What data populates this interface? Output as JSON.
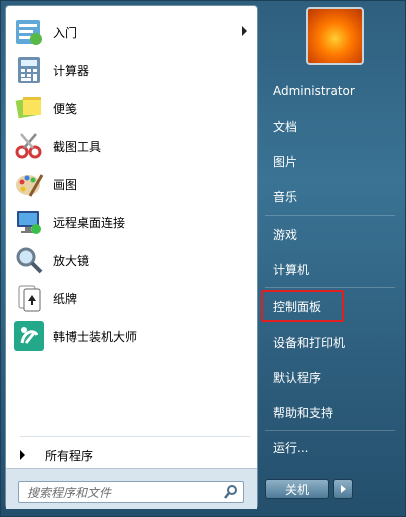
{
  "left": {
    "programs": [
      {
        "label": "入门",
        "icon": "getting-started-icon",
        "has_submenu": true
      },
      {
        "label": "计算器",
        "icon": "calculator-icon",
        "has_submenu": false
      },
      {
        "label": "便笺",
        "icon": "sticky-notes-icon",
        "has_submenu": false
      },
      {
        "label": "截图工具",
        "icon": "snipping-tool-icon",
        "has_submenu": false
      },
      {
        "label": "画图",
        "icon": "paint-icon",
        "has_submenu": false
      },
      {
        "label": "远程桌面连接",
        "icon": "remote-desktop-icon",
        "has_submenu": false
      },
      {
        "label": "放大镜",
        "icon": "magnifier-icon",
        "has_submenu": false
      },
      {
        "label": "纸牌",
        "icon": "solitaire-icon",
        "has_submenu": false
      },
      {
        "label": "韩博士装机大师",
        "icon": "installer-icon",
        "has_submenu": false
      }
    ],
    "all_programs": "所有程序",
    "search": {
      "placeholder": "搜索程序和文件"
    }
  },
  "right": {
    "items": [
      {
        "label": "Administrator"
      },
      {
        "label": "文档"
      },
      {
        "label": "图片"
      },
      {
        "label": "音乐"
      },
      {
        "label": "游戏"
      },
      {
        "label": "计算机"
      },
      {
        "label": "控制面板",
        "highlighted": true
      },
      {
        "label": "设备和打印机"
      },
      {
        "label": "默认程序"
      },
      {
        "label": "帮助和支持"
      },
      {
        "label": "运行..."
      }
    ],
    "shutdown_label": "关机"
  },
  "colors": {
    "highlight_box": "#e02020",
    "panel_blue": "#2f5f7e"
  }
}
